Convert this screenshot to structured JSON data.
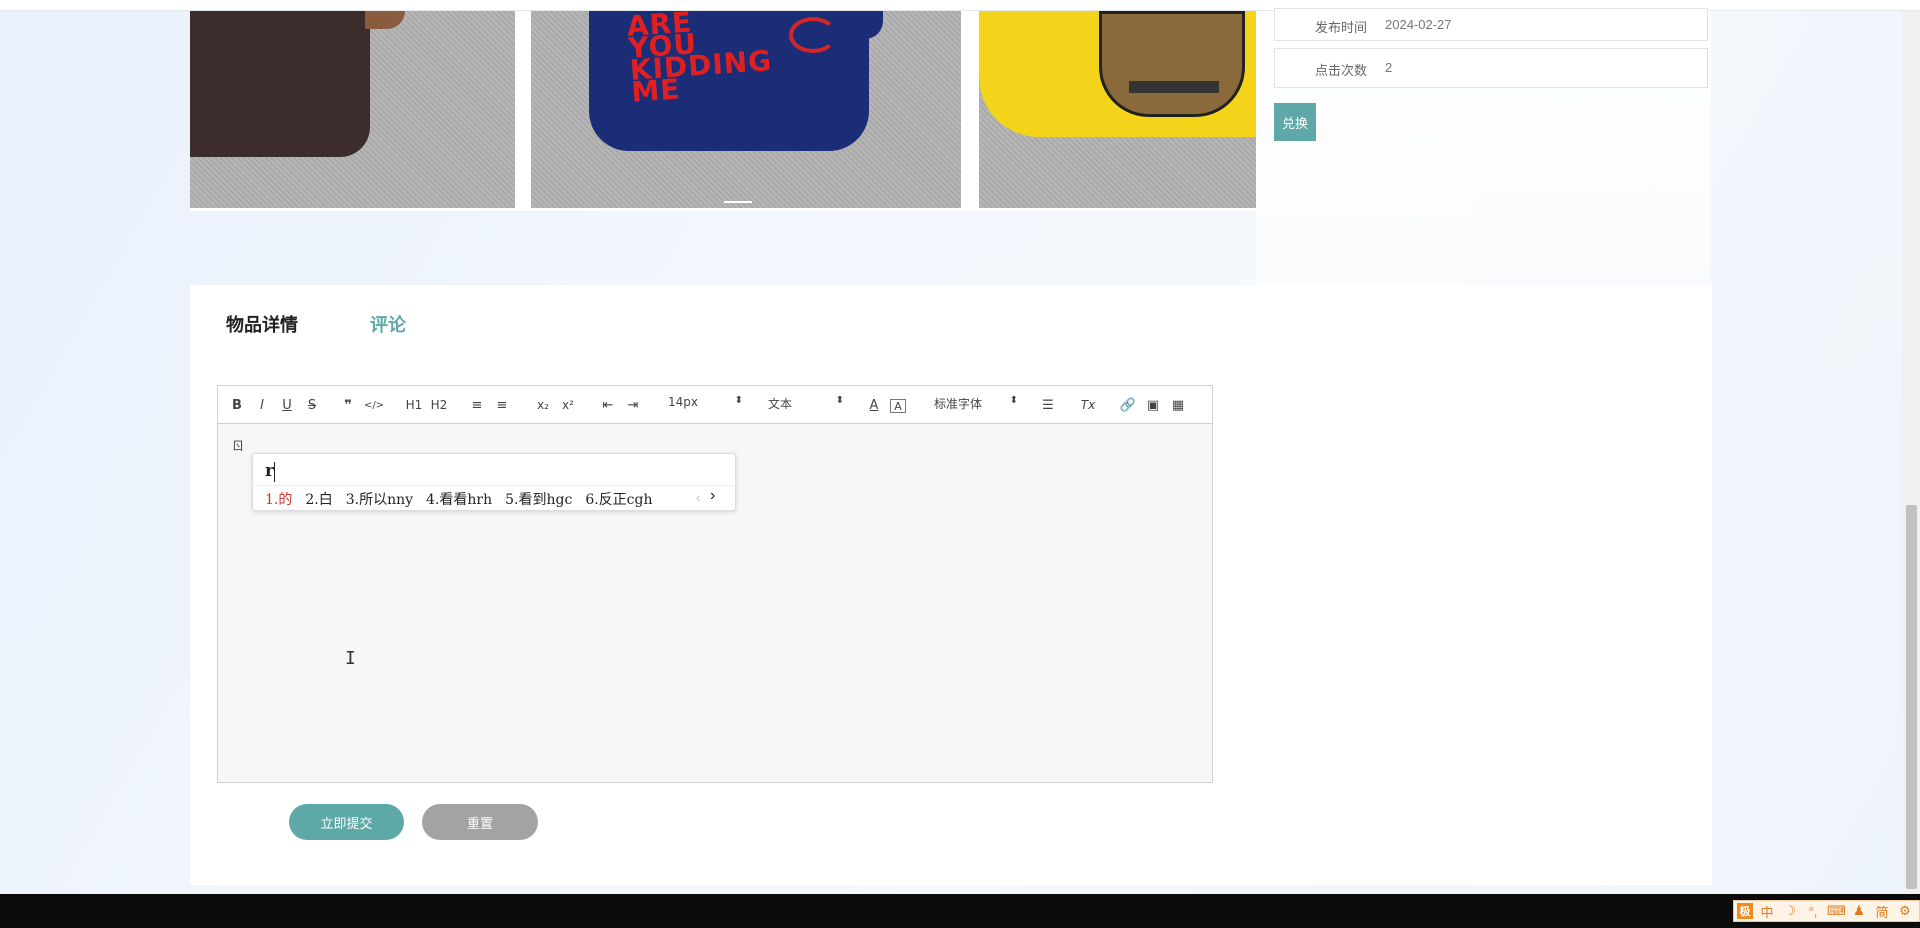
{
  "colors": {
    "accent": "#5ea9a7",
    "reset_gray": "#a3a3a3",
    "ime_highlight": "#c0392b"
  },
  "carousel": {
    "slide2_text": "ARE YOU KIDDING ME"
  },
  "info": {
    "date_label": "发布时间",
    "date_value": "2024-02-27",
    "clicks_label": "点击次数",
    "clicks_value": "2",
    "exchange_label": "兑换"
  },
  "tabs": {
    "detail": "物品详情",
    "comment": "评论"
  },
  "toolbar": {
    "bold": "B",
    "italic": "I",
    "underline": "U",
    "strike": "S",
    "quote": "❞",
    "code": "</>",
    "h1": "H1",
    "h2": "H2",
    "ordered": "≡",
    "bullet": "≡",
    "sub": "x₂",
    "sup": "x²",
    "outdent": "⇤",
    "indent": "⇥",
    "size_value": "14px",
    "header_value": "文本",
    "font_value": "标准字体",
    "align": "☰",
    "clean": "Tx",
    "link": "🔗",
    "image": "▣",
    "video": "▦"
  },
  "editor": {
    "content_char": "ㄖ"
  },
  "ime": {
    "input": "r",
    "candidates": [
      "1.的",
      "2.白",
      "3.所以nny",
      "4.看看hrh",
      "5.看到hgc",
      "6.反正cgh"
    ],
    "prev": "‹",
    "next": "›"
  },
  "cursor_glyph": "I",
  "buttons": {
    "submit": "立即提交",
    "reset": "重置"
  },
  "tray": {
    "logo": "极",
    "items": [
      "中",
      "☽",
      "°,",
      "⌨",
      "♟",
      "简",
      "⚙"
    ]
  }
}
